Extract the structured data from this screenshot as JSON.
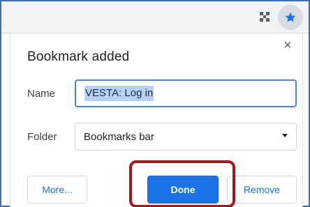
{
  "toolbar": {
    "extension_icon": "puzzle-extension-icon",
    "bookmark_star_icon": "star-icon",
    "accent_color": "#1a73e8"
  },
  "dialog": {
    "title": "Bookmark added",
    "close_icon": "close-icon",
    "close_glyph": "×",
    "name_label": "Name",
    "name_value": "VESTA: Log in",
    "folder_label": "Folder",
    "folder_value": "Bookmarks bar",
    "buttons": {
      "more": "More...",
      "done": "Done",
      "remove": "Remove"
    },
    "highlight_color": "#a3181b"
  }
}
